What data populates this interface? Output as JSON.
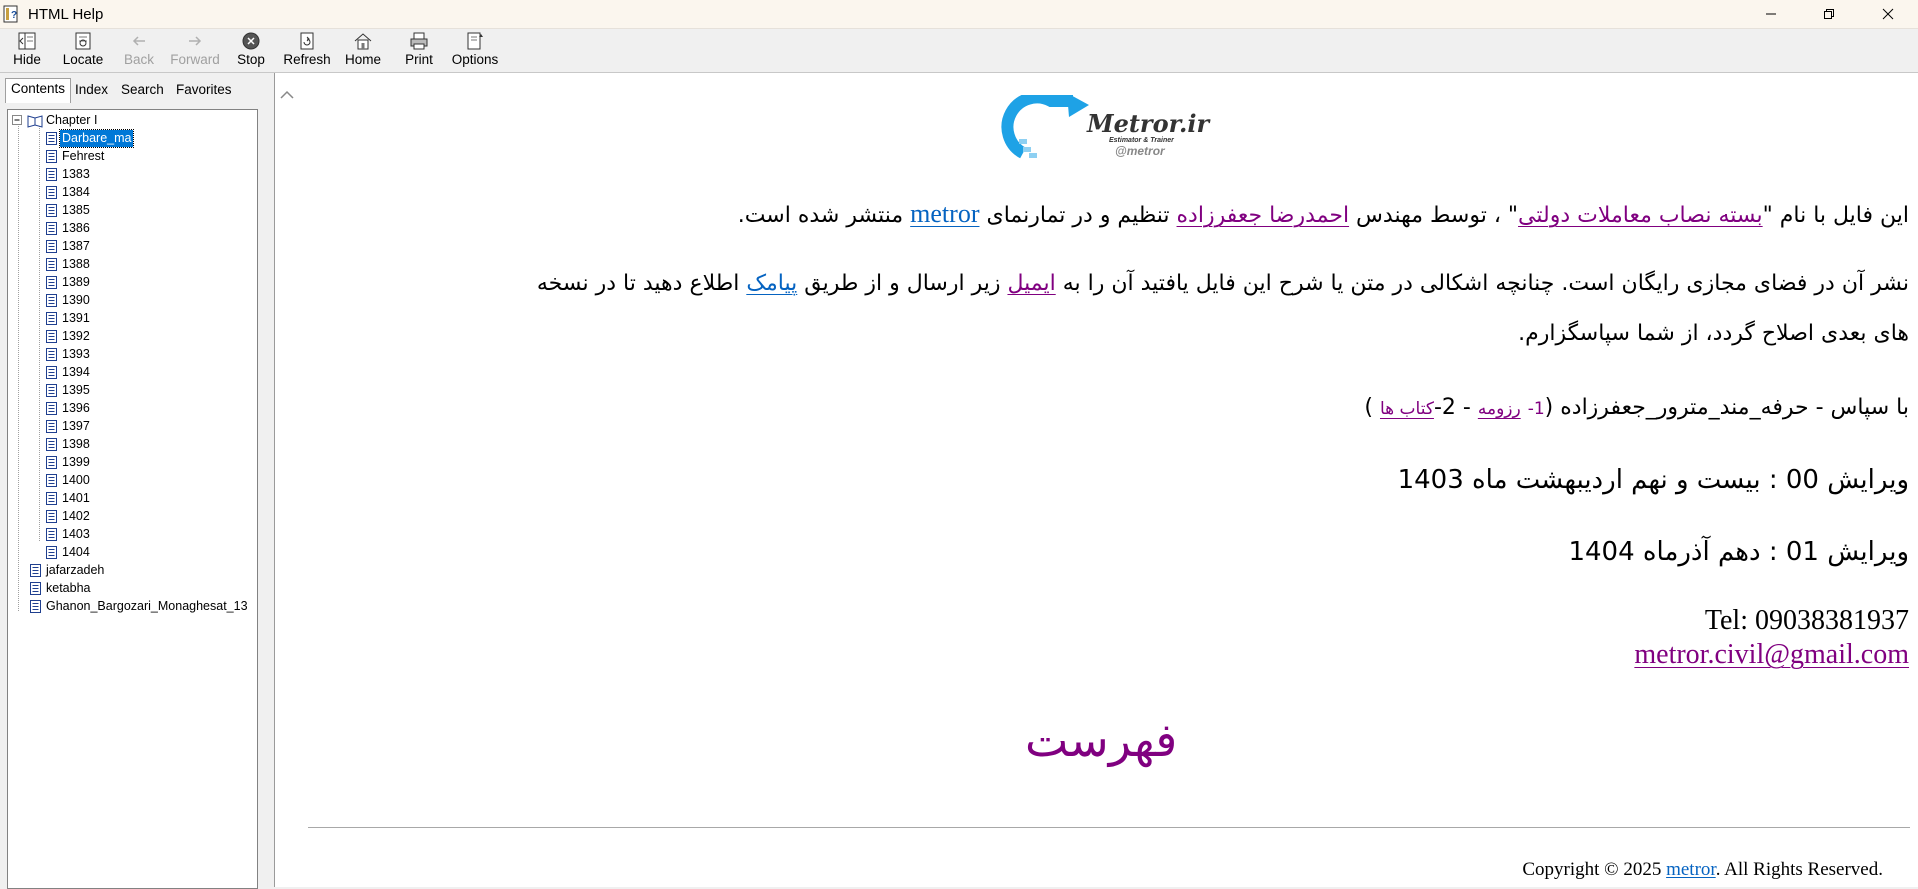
{
  "window": {
    "title": "HTML Help"
  },
  "toolbar": {
    "hide": "Hide",
    "locate": "Locate",
    "back": "Back",
    "forward": "Forward",
    "stop": "Stop",
    "refresh": "Refresh",
    "home": "Home",
    "print": "Print",
    "options": "Options"
  },
  "tabs": {
    "contents": "Contents",
    "index": "Index",
    "search": "Search",
    "favorites": "Favorites"
  },
  "tree": {
    "chapter": "Chapter I",
    "items": [
      "Darbare_ma",
      "Fehrest",
      "1383",
      "1384",
      "1385",
      "1386",
      "1387",
      "1388",
      "1389",
      "1390",
      "1391",
      "1392",
      "1393",
      "1394",
      "1395",
      "1396",
      "1397",
      "1398",
      "1399",
      "1400",
      "1401",
      "1402",
      "1403",
      "1404"
    ],
    "root_items": [
      "jafarzadeh",
      "ketabha",
      "Ghanon_Bargozari_Monaghesat_13"
    ]
  },
  "logo": {
    "brand": "Metror.ir",
    "tagline": "Estimator & Trainer",
    "handle": "@metror"
  },
  "content": {
    "p1_a": "این فایل با نام ",
    "p1_q1": "\"",
    "p1_link1": "بسته نصاب معاملات دولتی",
    "p1_q2": "\" ، توسط مهندس ",
    "p1_link2": "احمدرضا جعفرزاده",
    "p1_b": " تنظیم و در تمارنمای ",
    "p1_link3": "metror",
    "p1_c": " منتشر شده است.",
    "p2_a": "نشر آن در فضای مجازی رایگان است. چنانچه اشکالی در متن یا شرح این فایل یافتید آن را به ",
    "p2_link1": "ایمیل",
    "p2_b": " زیر ارسال و از طریق ",
    "p2_link2": "پیامک",
    "p2_c": " اطلاع دهید تا در نسخه",
    "p2_line2": "های بعدی اصلاح گردد، از شما سپاسگزارم.",
    "p3_a": "با سپاس - حرفه_مند_مترور_جعفرزاده (",
    "p3_n1": "1-",
    "p3_link1": "رزومه",
    "p3_sep": " - 2-",
    "p3_link2": "کتاب ها",
    "p3_end": ")",
    "edition0": "ویرایش 00 :  بیست و نهم اردیبهشت ماه 1403",
    "edition1": "ویرایش 01 : دهم آذرماه 1404",
    "tel": "Tel: 09038381937",
    "email": "metror.civil@gmail.com",
    "fehrest": "فهرست",
    "copy_a": "Copyright © 2025 ",
    "copy_link": "metror",
    "copy_b": ". All Rights Reserved."
  }
}
